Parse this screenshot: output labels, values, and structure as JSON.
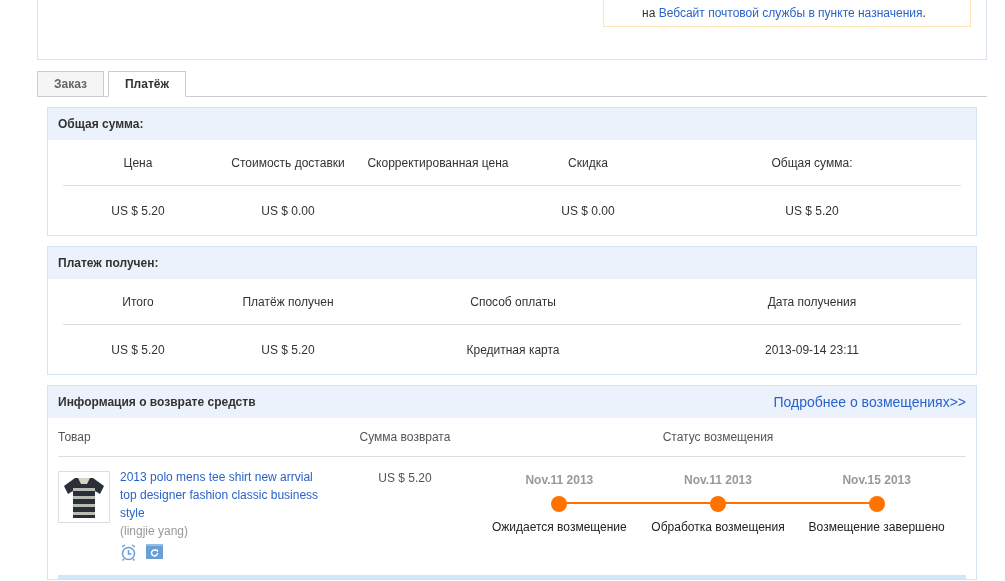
{
  "notice": {
    "prefix": "на ",
    "link": "Вебсайт почтовой службы в пункте назначения",
    "suffix": "."
  },
  "tabs": [
    {
      "label": "Заказ",
      "selected": false
    },
    {
      "label": "Платёж",
      "selected": true
    }
  ],
  "total": {
    "title": "Общая сумма:",
    "columns": [
      {
        "label": "Цена",
        "value": "US $ 5.20"
      },
      {
        "label": "Стоимость доставки",
        "value": "US $ 0.00"
      },
      {
        "label": "Скорректированная цена"
      },
      {
        "label": "Скидка",
        "value": "US $ 0.00"
      },
      {
        "label": "Общая сумма:",
        "value": "US $ 5.20"
      }
    ]
  },
  "payment": {
    "title": "Платеж получен:",
    "columns": [
      {
        "label": "Итого",
        "value": "US $ 5.20"
      },
      {
        "label": "Платёж получен",
        "value": "US $ 5.20"
      },
      {
        "label": "Способ оплаты",
        "value": "Кредитная карта"
      },
      {
        "label": "Дата получения",
        "value": "2013-09-14 23:11"
      }
    ]
  },
  "refund": {
    "title": "Информация о возврате средств",
    "more_link": "Подробнее о возмещениях>>",
    "columns": [
      "Товар",
      "Сумма возврата",
      "Статус возмещения"
    ],
    "item": {
      "kind": "picture",
      "name": "2013 polo mens tee shirt new arrvial top designer fashion classic business style",
      "seller": "(lingjie yang)",
      "amount": "US $ 5.20"
    },
    "steps": [
      {
        "date": "Nov.11 2013",
        "label": "Ожидается возмещение",
        "done": true
      },
      {
        "date": "Nov.11 2013",
        "label": "Обработка возмещения",
        "done": true
      },
      {
        "date": "Nov.15 2013",
        "label": "Возмещение завершено",
        "done": true
      }
    ]
  }
}
